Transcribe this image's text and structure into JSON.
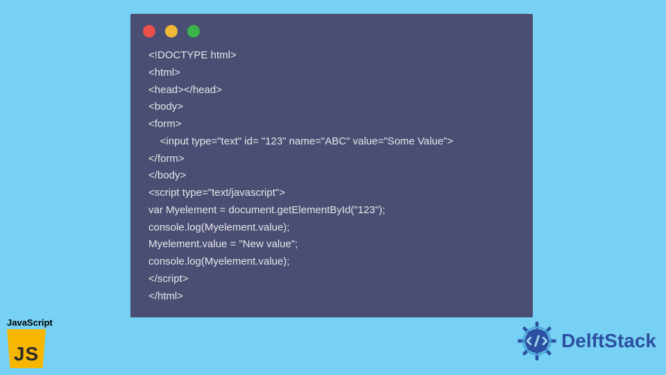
{
  "code_window": {
    "lines": [
      "<!DOCTYPE html>",
      "<html>",
      "<head></head>",
      "<body>",
      "<form>",
      "    <input type=\"text\" id= \"123\" name=\"ABC\" value=\"Some Value\">",
      "</form>",
      "</body>",
      "<script type=\"text/javascript\">",
      "var Myelement = document.getElementById(\"123\");",
      "console.log(Myelement.value);",
      "Myelement.value = \"New value\";",
      "console.log(Myelement.value);",
      "</script>",
      "</html>"
    ]
  },
  "js_badge": {
    "label": "JavaScript",
    "logo_text": "JS"
  },
  "brand": {
    "name": "DelftStack"
  },
  "colors": {
    "page_bg": "#77d1f4",
    "window_bg": "#4a4e72",
    "dot_red": "#eb4e4b",
    "dot_yellow": "#f0b93a",
    "dot_green": "#3bb54a",
    "js_yellow": "#f7b700",
    "brand_blue": "#2b50a1"
  }
}
